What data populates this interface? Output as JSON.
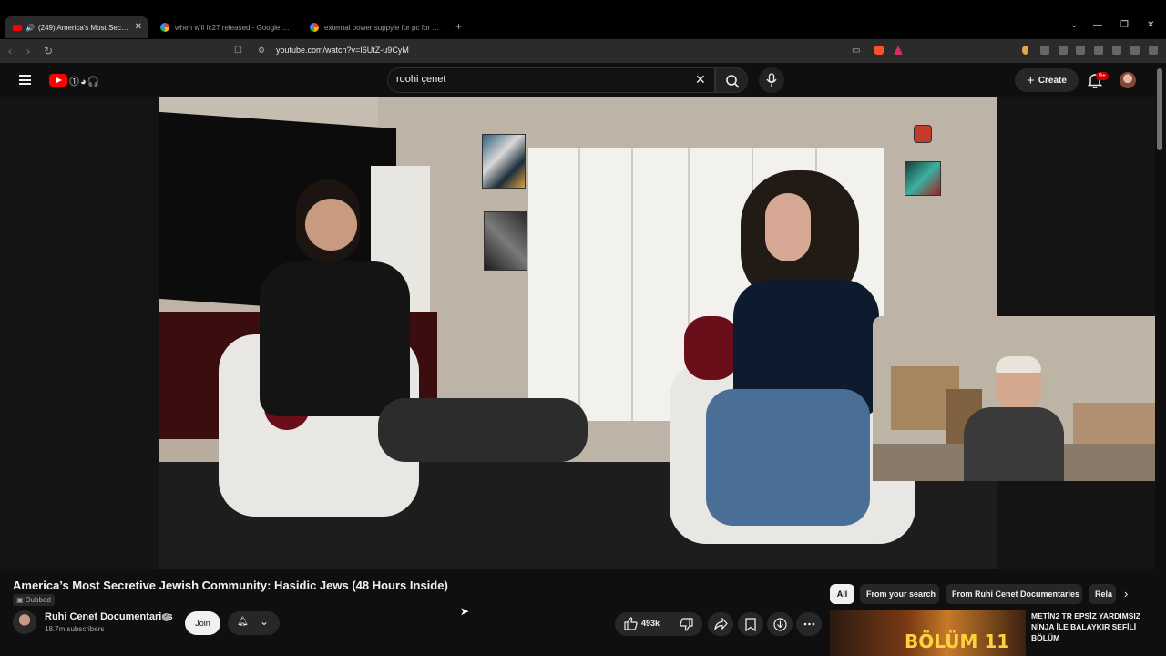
{
  "browser": {
    "tabs": [
      {
        "label": "(249) America's Most Secretiv"
      },
      {
        "label": "when w'll fc27 released - Google Sea"
      },
      {
        "label": "external power suppyle for pc for ele"
      }
    ],
    "new_tab": "+",
    "url": "youtube.com/watch?v=I6UtZ-u9CyM"
  },
  "header": {
    "search_value": "roohi çenet",
    "create_label": "Create",
    "notif_badge": "9+"
  },
  "video": {
    "title": "America’s Most Secretive Jewish Community: Hasidic Jews (48 Hours Inside)",
    "dubbed_label": "Dubbed",
    "channel_name": "Ruhi Cenet Documentaries",
    "subscribers": "18.7m subscribers",
    "join_label": "Join",
    "like_count": "493k"
  },
  "chips": [
    "All",
    "From your search",
    "From Ruhi Cenet Documentaries",
    "Rela"
  ],
  "recommended": {
    "thumb_text": "BÖLÜM 11",
    "title": "METİN2 TR EPSİZ YARDIMSIZ NİNJA İLE BALAYKIR SEFİLİ BÖLÜM"
  },
  "colors": {
    "accent": "#ff0000",
    "background": "#0f0f0f",
    "chip_bg": "#272727"
  }
}
